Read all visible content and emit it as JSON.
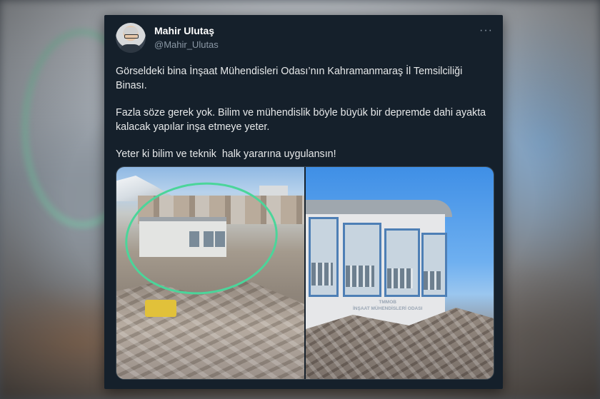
{
  "tweet": {
    "author_name": "Mahir Ulutaş",
    "author_handle": "@Mahir_Ulutas",
    "more_glyph": "···",
    "paragraphs": [
      "Görseldeki bina İnşaat Mühendisleri Odası’nın Kahramanmaraş İl Temsilciliği Binası.",
      "Fazla söze gerek yok. Bilim ve mühendislik böyle büyük bir depremde dahi ayakta kalacak yapılar inşa etmeye yeter.",
      "Yeter ki bilim ve teknik  halk yararına uygulansın!"
    ],
    "media": {
      "right_sign_line1": "TMMOB",
      "right_sign_line2": "İNŞAAT MÜHENDİSLERİ ODASI",
      "highlight_color": "#4bd59a"
    }
  },
  "colors": {
    "card_background": "#15202b",
    "primary_text": "#e7e9ea",
    "secondary_text": "#8b98a5"
  }
}
